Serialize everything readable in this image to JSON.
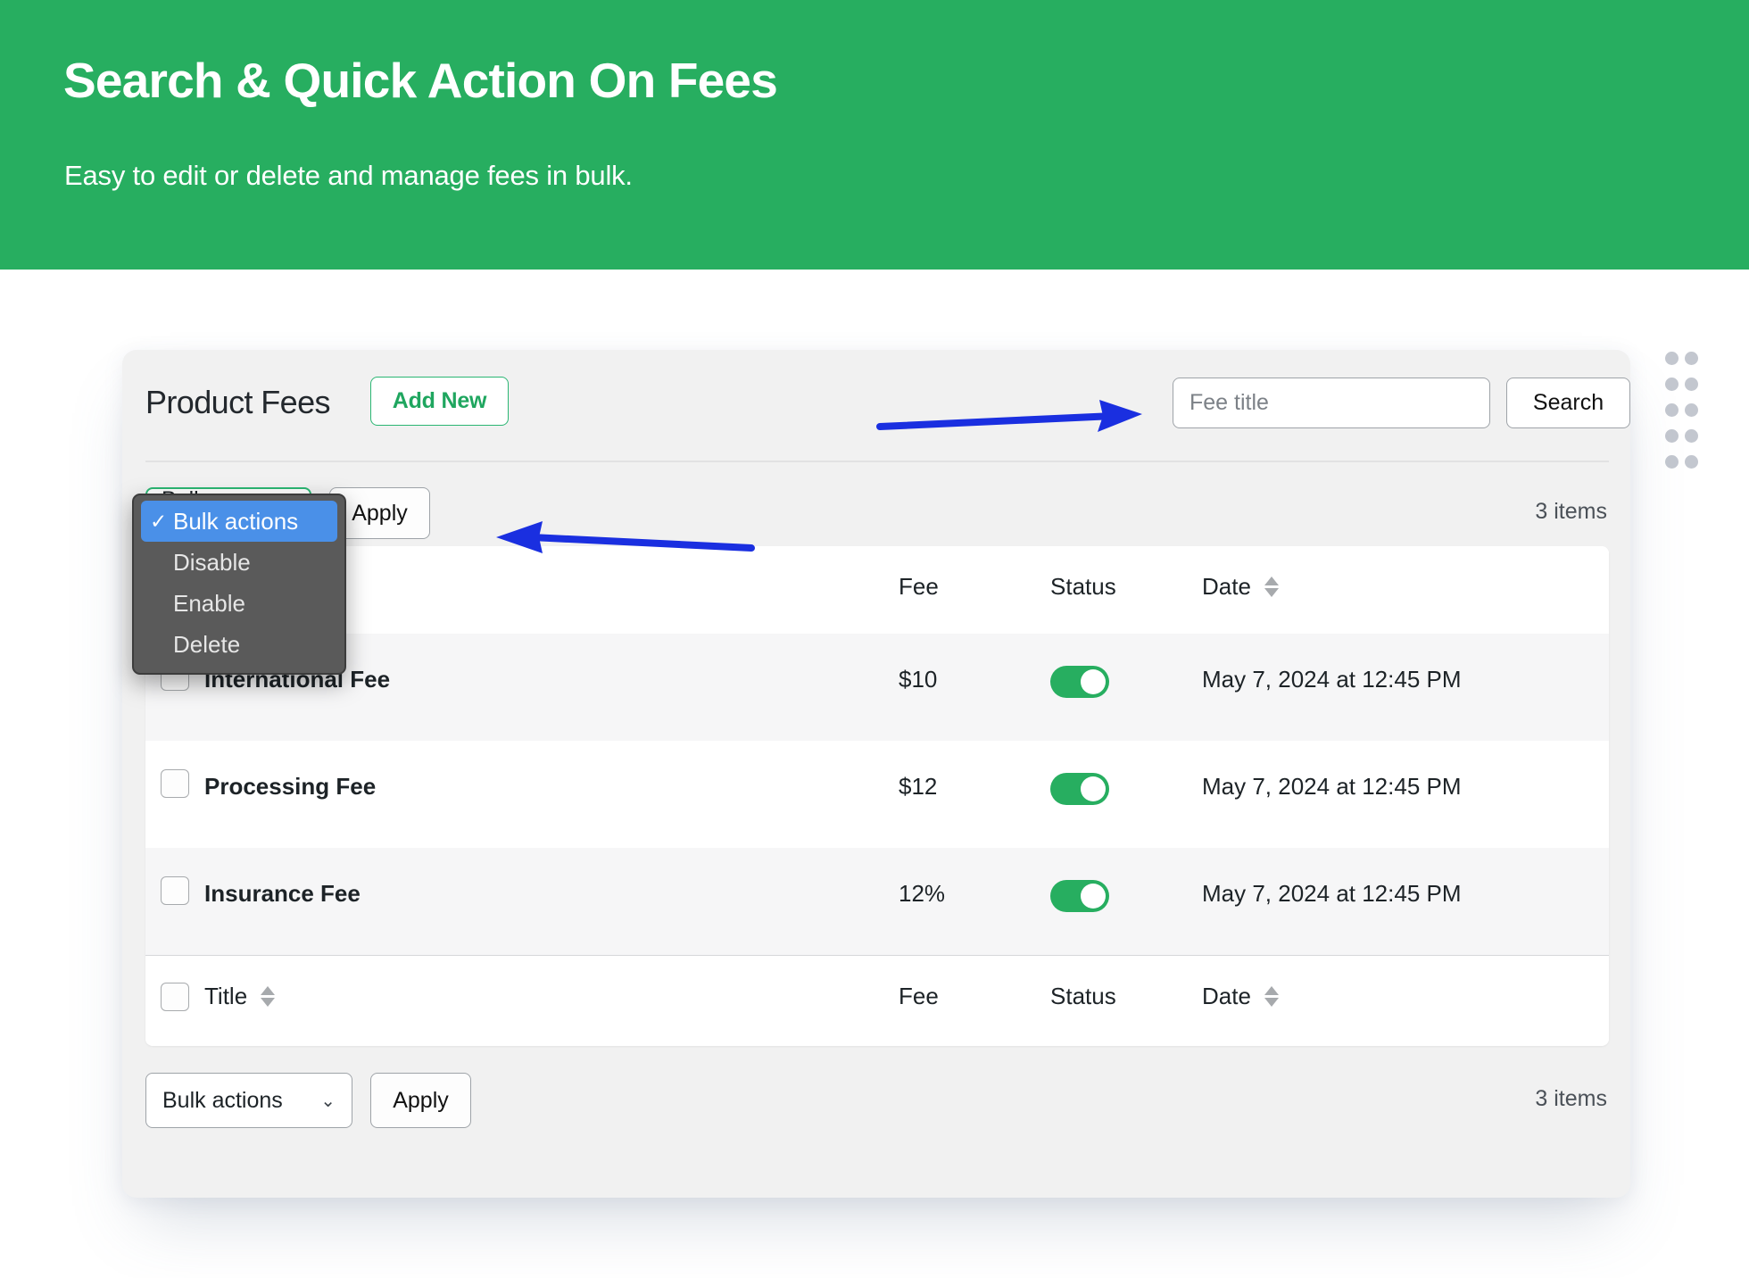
{
  "hero": {
    "title": "Search & Quick Action On Fees",
    "subtitle": "Easy to edit or delete and manage fees in bulk.",
    "bg_color": "#27ae60"
  },
  "card": {
    "title": "Product Fees",
    "add_new_label": "Add New",
    "accent_color": "#2bb673"
  },
  "search": {
    "placeholder": "Fee title",
    "value": "",
    "button_label": "Search"
  },
  "bulk_top": {
    "select_value": "Bulk actions",
    "chevron": "⌄",
    "apply_label": "Apply",
    "items_count": "3 items"
  },
  "dropdown": {
    "open": true,
    "check_glyph": "✓",
    "highlight_color": "#4a90e8",
    "items": [
      {
        "label": "Bulk actions",
        "selected": true
      },
      {
        "label": "Disable",
        "selected": false
      },
      {
        "label": "Enable",
        "selected": false
      },
      {
        "label": "Delete",
        "selected": false
      }
    ]
  },
  "table": {
    "header": {
      "title": "",
      "fee": "Fee",
      "status": "Status",
      "date": "Date"
    },
    "footer_header": {
      "title": "Title",
      "fee": "Fee",
      "status": "Status",
      "date": "Date"
    },
    "rows": [
      {
        "title": "International Fee",
        "fee": "$10",
        "status_on": true,
        "date": "May 7, 2024 at 12:45 PM",
        "checked": false
      },
      {
        "title": "Processing Fee",
        "fee": "$12",
        "status_on": true,
        "date": "May 7, 2024 at 12:45 PM",
        "checked": false
      },
      {
        "title": "Insurance Fee",
        "fee": "12%",
        "status_on": true,
        "date": "May 7, 2024 at 12:45 PM",
        "checked": false
      }
    ]
  },
  "bulk_bottom": {
    "select_value": "Bulk actions",
    "chevron": "⌄",
    "apply_label": "Apply",
    "items_count": "3 items"
  },
  "annotations": {
    "arrow_color": "#1a2fe0",
    "arrow_search_target": "search-input",
    "arrow_bulk_target": "bulk-actions-select"
  },
  "decoration": {
    "dot_color": "#c3c7cf",
    "dot_rows": 5,
    "dot_cols": 2
  }
}
